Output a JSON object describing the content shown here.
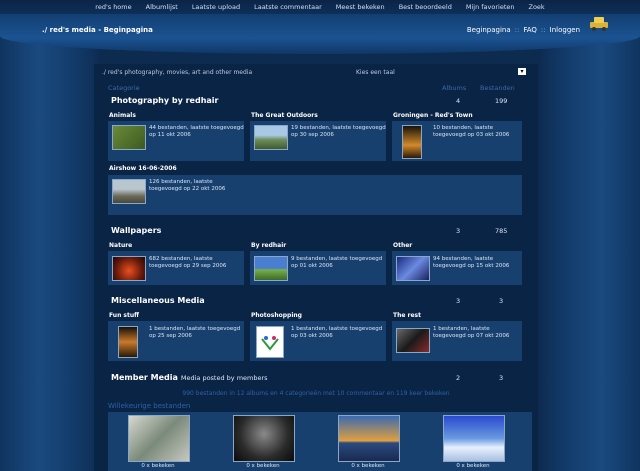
{
  "topnav": [
    "red's home",
    "Albumlijst",
    "Laatste upload",
    "Laatste commentaar",
    "Meest bekeken",
    "Best beoordeeld",
    "Mijn favorieten",
    "Zoek"
  ],
  "header": {
    "title": "./ red's media - Beginpagina",
    "links": [
      "Beginpagina",
      "FAQ",
      "Inloggen"
    ],
    "separator": "::"
  },
  "breadcrumb": "./ red's photography, movies, art and other media",
  "select": {
    "label": "Kies een taal",
    "arrow": "▾"
  },
  "columns": {
    "category": "Categorie",
    "albums": "Albums",
    "files": "Bestanden"
  },
  "sections": [
    {
      "title": "Photography by redhair",
      "subtitle": "",
      "albums": "4",
      "files": "199",
      "categories": [
        {
          "name": "Animals",
          "info": "44 bestanden, laatste toegevoegd op 11 okt 2006"
        },
        {
          "name": "The Great Outdoors",
          "info": "19 bestanden, laatste toegevoegd op 30 sep 2006"
        },
        {
          "name": "Groningen - Red's Town",
          "info": "10 bestanden, laatste toegevoegd op 03 okt 2006"
        },
        {
          "name": "Airshow 16-06-2006",
          "info": "126 bestanden, laatste toegevoegd op 22 okt 2006"
        }
      ]
    },
    {
      "title": "Wallpapers",
      "subtitle": "",
      "albums": "3",
      "files": "785",
      "categories": [
        {
          "name": "Nature",
          "info": "682 bestanden, laatste toegevoegd op 29 sep 2006"
        },
        {
          "name": "By redhair",
          "info": "9 bestanden, laatste toegevoegd op 01 okt 2006"
        },
        {
          "name": "Other",
          "info": "94 bestanden, laatste toegevoegd op 15 okt 2006"
        }
      ]
    },
    {
      "title": "Miscellaneous Media",
      "subtitle": "",
      "albums": "3",
      "files": "3",
      "categories": [
        {
          "name": "Fun stuff",
          "info": "1 bestanden, laatste toegevoegd op 25 sep 2006"
        },
        {
          "name": "Photoshopping",
          "info": "1 bestanden, laatste toegevoegd op 03 okt 2006"
        },
        {
          "name": "The rest",
          "info": "1 bestanden, laatste toegevoegd op 07 okt 2006"
        }
      ]
    },
    {
      "title": "Member Media",
      "subtitle": "Media posted by members",
      "albums": "2",
      "files": "3",
      "categories": []
    }
  ],
  "stats": "990 bestanden in 12 albums en 4 categorieën met 10 commentaar en 119 keer bekeken",
  "random": {
    "title": "Willekeurige bestanden",
    "captions": [
      "0 x bekeken",
      "0 x bekeken",
      "0 x bekeken",
      "0 x bekeken"
    ]
  }
}
